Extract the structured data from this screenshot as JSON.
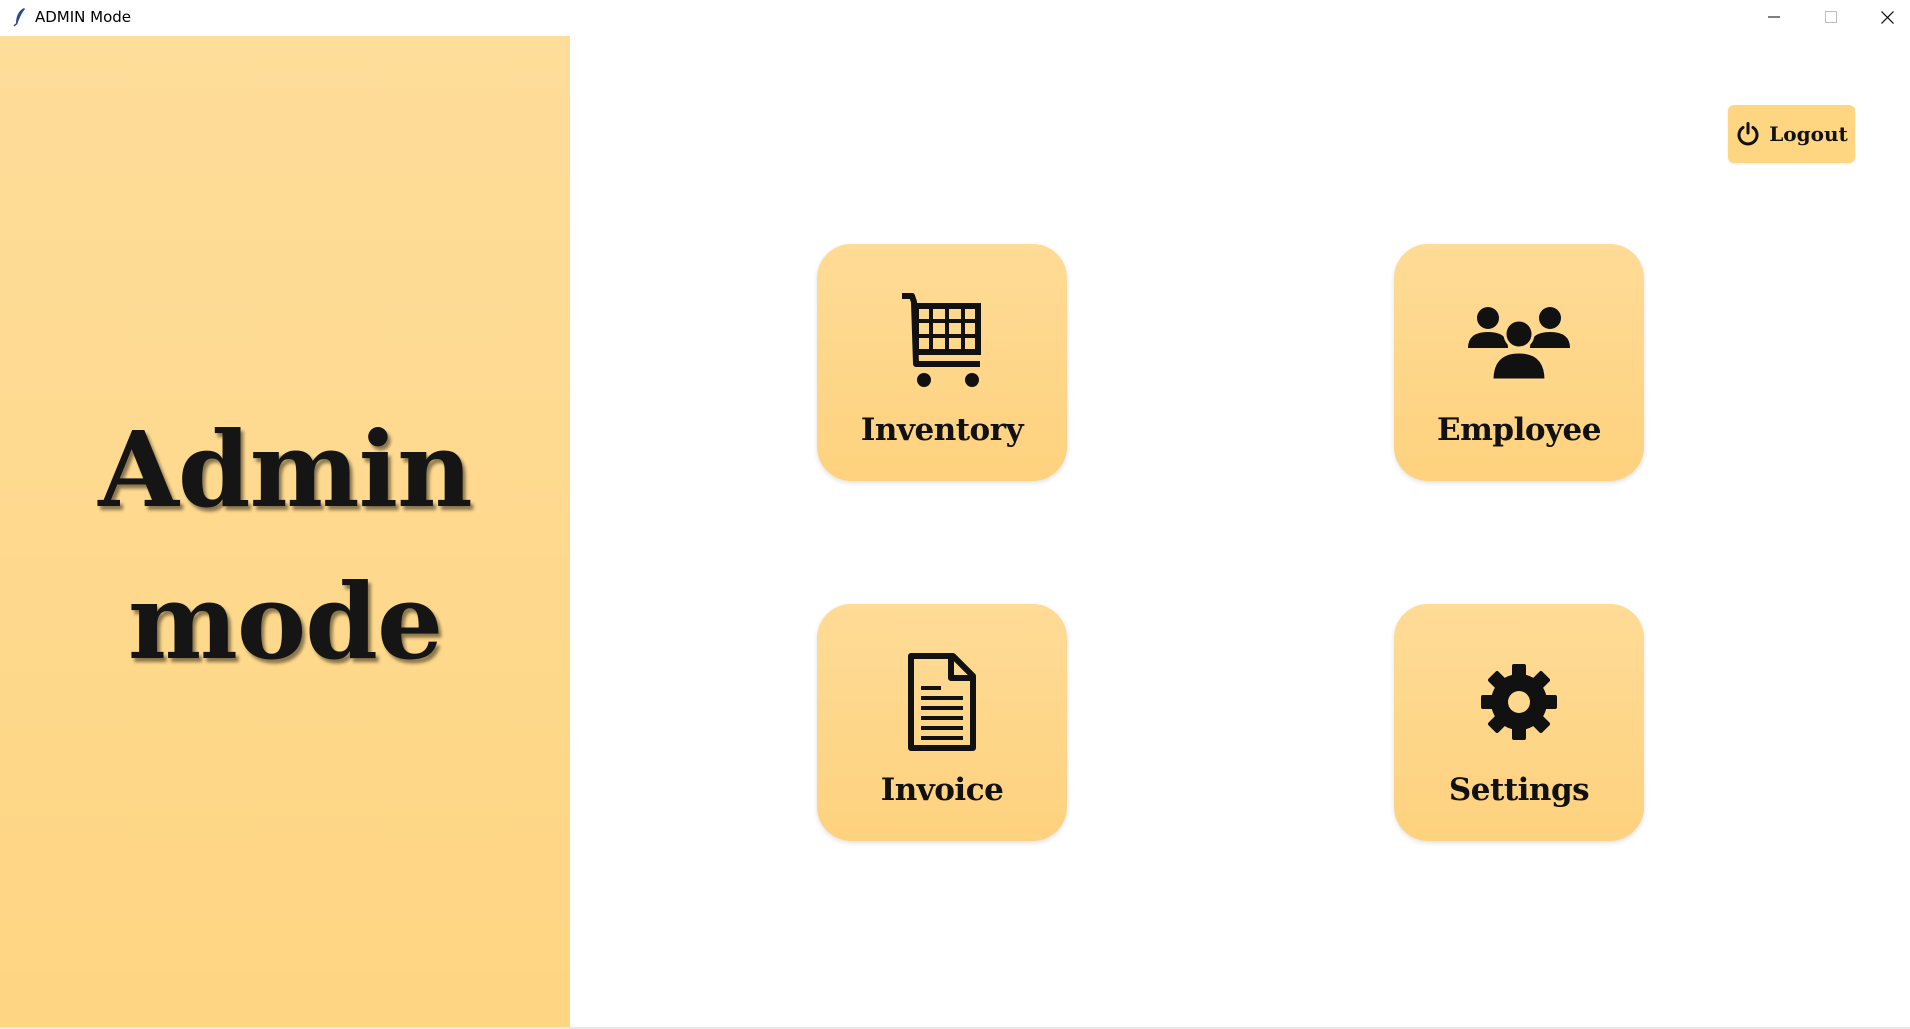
{
  "window": {
    "title": "ADMIN Mode",
    "controls": {
      "minimize_icon": "minimize-icon",
      "maximize_icon": "maximize-icon",
      "close_icon": "close-icon"
    }
  },
  "panel": {
    "line1": "Admin",
    "line2": "mode",
    "background": "#fed88c"
  },
  "logout": {
    "label": "Logout",
    "icon": "power-icon"
  },
  "tiles": [
    {
      "label": "Inventory",
      "icon": "shopping-cart-icon"
    },
    {
      "label": "Employee",
      "icon": "people-group-icon"
    },
    {
      "label": "Invoice",
      "icon": "document-icon"
    },
    {
      "label": "Settings",
      "icon": "gear-icon"
    }
  ],
  "colors": {
    "accent": "#fed682",
    "text": "#111111"
  }
}
